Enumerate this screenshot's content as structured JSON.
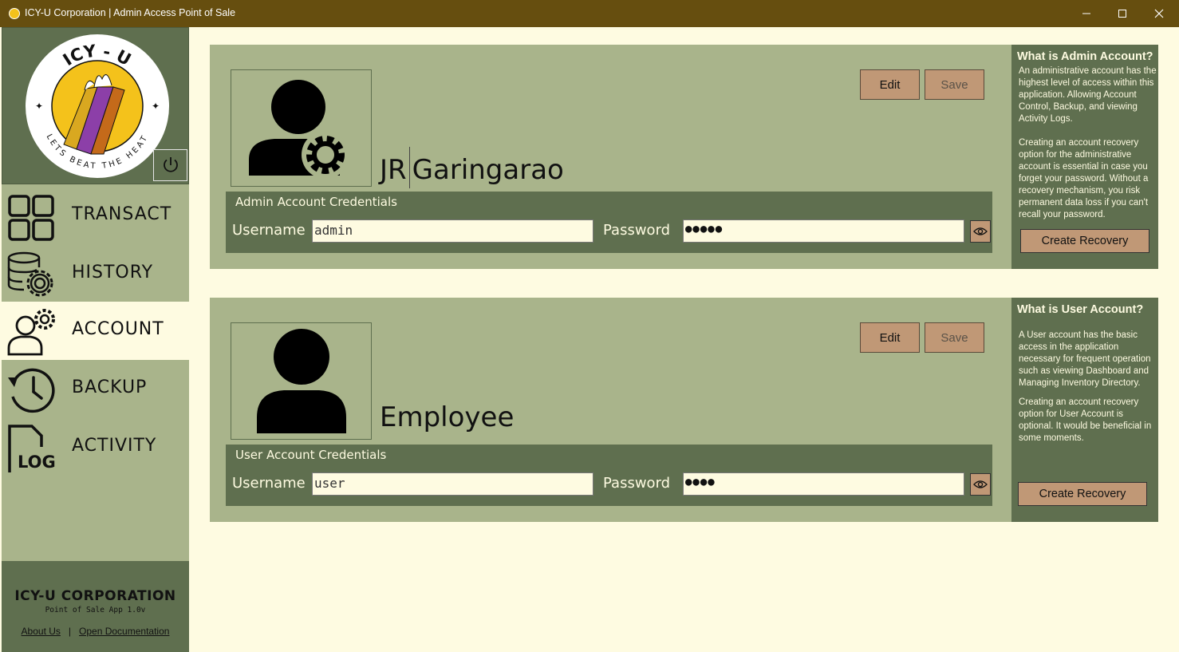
{
  "window": {
    "title": "ICY-U Corporation | Admin Access Point of Sale"
  },
  "logo": {
    "top_text": "ICY - U",
    "bottom_text": "LETS BEAT THE HEAT"
  },
  "nav": [
    {
      "label": "TRANSACT",
      "icon": "dashboard-grid-icon"
    },
    {
      "label": "HISTORY",
      "icon": "database-gear-icon"
    },
    {
      "label": "ACCOUNT",
      "icon": "user-gear-icon"
    },
    {
      "label": "BACKUP",
      "icon": "history-clock-icon"
    },
    {
      "label": "ACTIVITY",
      "icon": "log-file-icon"
    }
  ],
  "active_nav": "ACCOUNT",
  "footer": {
    "company": "ICY-U CORPORATION",
    "version": "Point of Sale App 1.0v",
    "about_link": "About Us",
    "separator": "|",
    "docs_link": "Open Documentation"
  },
  "admin_card": {
    "first_name": "JR",
    "last_name": "Garingarao",
    "edit_label": "Edit",
    "save_label": "Save",
    "cred_title": "Admin Account Credentials",
    "username_label": "Username",
    "username_value": "admin",
    "password_label": "Password",
    "password_value": "●●●●●",
    "info_title": "What is Admin Account?",
    "info_text_1": "An administrative account has the highest level of access within this application. Allowing Account Control, Backup, and viewing Activity Logs.",
    "info_text_2": "Creating an account recovery option for the administrative account is essential in case you forget your password. Without a recovery mechanism, you risk permanent data loss if you can't recall your password.",
    "recovery_label": "Create Recovery"
  },
  "user_card": {
    "name": "Employee",
    "edit_label": "Edit",
    "save_label": "Save",
    "cred_title": "User Account Credentials",
    "username_label": "Username",
    "username_value": "user",
    "password_label": "Password",
    "password_value": "●●●●",
    "info_title": "What is User Account?",
    "info_text_1": "A User account has the basic access in the application necessary for frequent operation such as viewing Dashboard and Managing Inventory Directory.",
    "info_text_2": "Creating an account recovery option for User Account is optional. It would be beneficial in some moments.",
    "recovery_label": "Create Recovery"
  },
  "colors": {
    "title_bar": "#664e0f",
    "sidebar": "#a9b48b",
    "dark_green": "#5f6f4f",
    "cream": "#fefbe1",
    "button": "#c09876"
  }
}
